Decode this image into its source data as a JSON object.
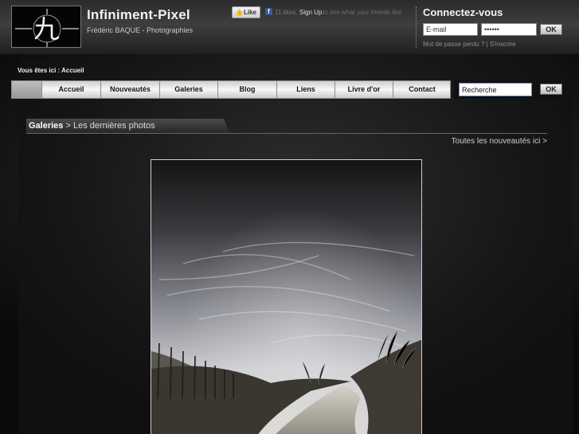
{
  "site": {
    "title": "Infiniment-Pixel",
    "subtitle": "Frédéric BAQUE - Photographies"
  },
  "facebook": {
    "like_label": "Like",
    "likes_text": "11 likes.",
    "signup_label": "Sign Up",
    "see_text": "to see what your friends like"
  },
  "login": {
    "title": "Connectez-vous",
    "email_value": "E-mail",
    "password_value": "••••••",
    "ok_label": "OK",
    "forgot_label": "Mot de passe perdu ?",
    "separator": "|",
    "register_label": "S'inscrire"
  },
  "breadcrumb": {
    "prefix": "Vous êtes ici :",
    "current": "Accueil"
  },
  "nav": {
    "items": [
      "Accueil",
      "Nouveautés",
      "Galeries",
      "Blog",
      "Liens",
      "Livre d'or",
      "Contact"
    ]
  },
  "search": {
    "value": "Recherche",
    "ok_label": "OK"
  },
  "gallery": {
    "section_link": "Galeries",
    "section_rest": "> Les dernières photos",
    "all_news_label": "Toutes les nouveautés ici >"
  }
}
